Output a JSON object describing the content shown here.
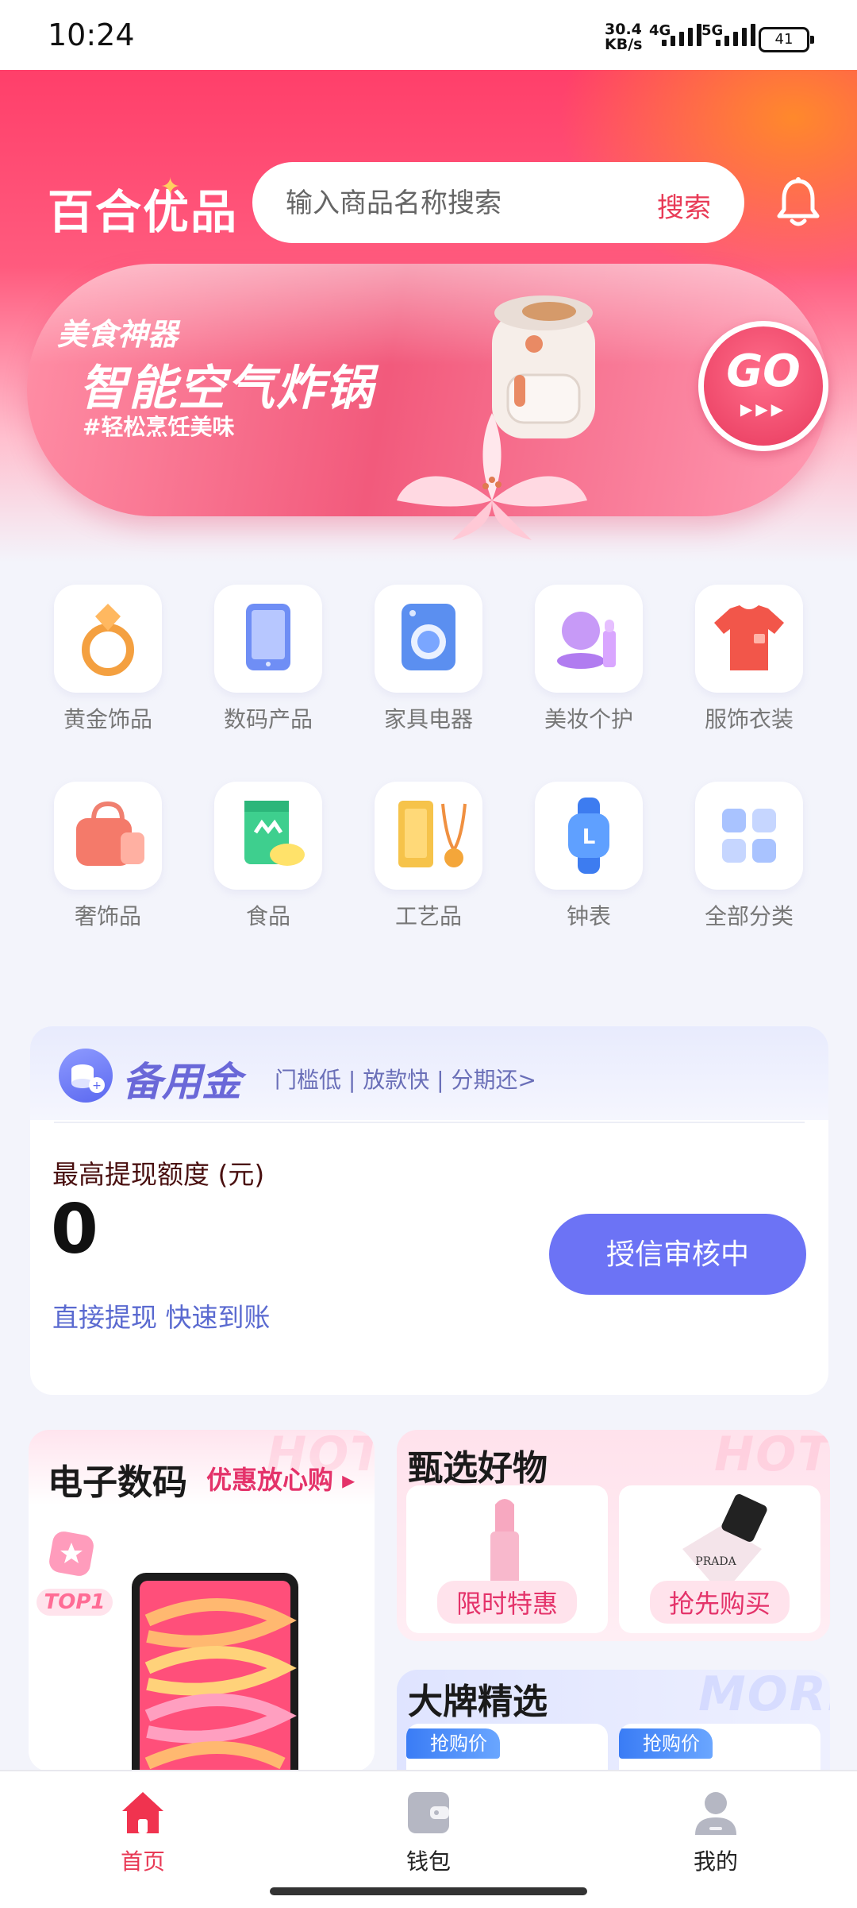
{
  "status_bar": {
    "time": "10:24",
    "net_speed_value": "30.4",
    "net_speed_unit": "KB/s",
    "sim1": "4G",
    "sim2": "5G",
    "battery": "41"
  },
  "header": {
    "logo": "百合优品",
    "search_placeholder": "输入商品名称搜索",
    "search_button": "搜索"
  },
  "banner": {
    "subtitle": "美食神器",
    "title": "智能空气炸锅",
    "tag": "#轻松烹饪美味",
    "go_label": "GO",
    "go_arrows": "▶▶▶"
  },
  "categories": [
    {
      "label": "黄金饰品",
      "icon": "gold-ring-icon"
    },
    {
      "label": "数码产品",
      "icon": "tablet-icon"
    },
    {
      "label": "家具电器",
      "icon": "washing-machine-icon"
    },
    {
      "label": "美妆个护",
      "icon": "makeup-icon"
    },
    {
      "label": "服饰衣装",
      "icon": "tshirt-icon"
    },
    {
      "label": "奢饰品",
      "icon": "handbag-icon"
    },
    {
      "label": "食品",
      "icon": "snack-icon"
    },
    {
      "label": "工艺品",
      "icon": "gold-bar-icon"
    },
    {
      "label": "钟表",
      "icon": "watch-icon"
    },
    {
      "label": "全部分类",
      "icon": "grid-icon"
    }
  ],
  "credit": {
    "brand": "备用金",
    "slogan": "门槛低 | 放款快 | 分期还>",
    "label": "最高提现额度 (元)",
    "amount": "0",
    "link": "直接提现 快速到账",
    "button": "授信审核中"
  },
  "sections": {
    "digital": {
      "title": "电子数码",
      "more": "优惠放心购 ▸",
      "badge": "TOP1",
      "watermark": "HOT"
    },
    "selected": {
      "title": "甄选好物",
      "watermark": "HOT",
      "items": [
        {
          "label": "限时特惠"
        },
        {
          "label": "抢先购买"
        }
      ]
    },
    "brand": {
      "title": "大牌精选",
      "watermark": "MORE",
      "tag": "抢购价"
    }
  },
  "product_brand_text": "PRADA",
  "bottom_nav": [
    {
      "label": "首页",
      "active": true,
      "icon": "home-icon"
    },
    {
      "label": "钱包",
      "active": false,
      "icon": "wallet-icon"
    },
    {
      "label": "我的",
      "active": false,
      "icon": "profile-icon"
    }
  ],
  "colors": {
    "brand_red": "#e83a56",
    "credit_blue": "#6c73f5",
    "link_blue": "#5a6ad0"
  }
}
